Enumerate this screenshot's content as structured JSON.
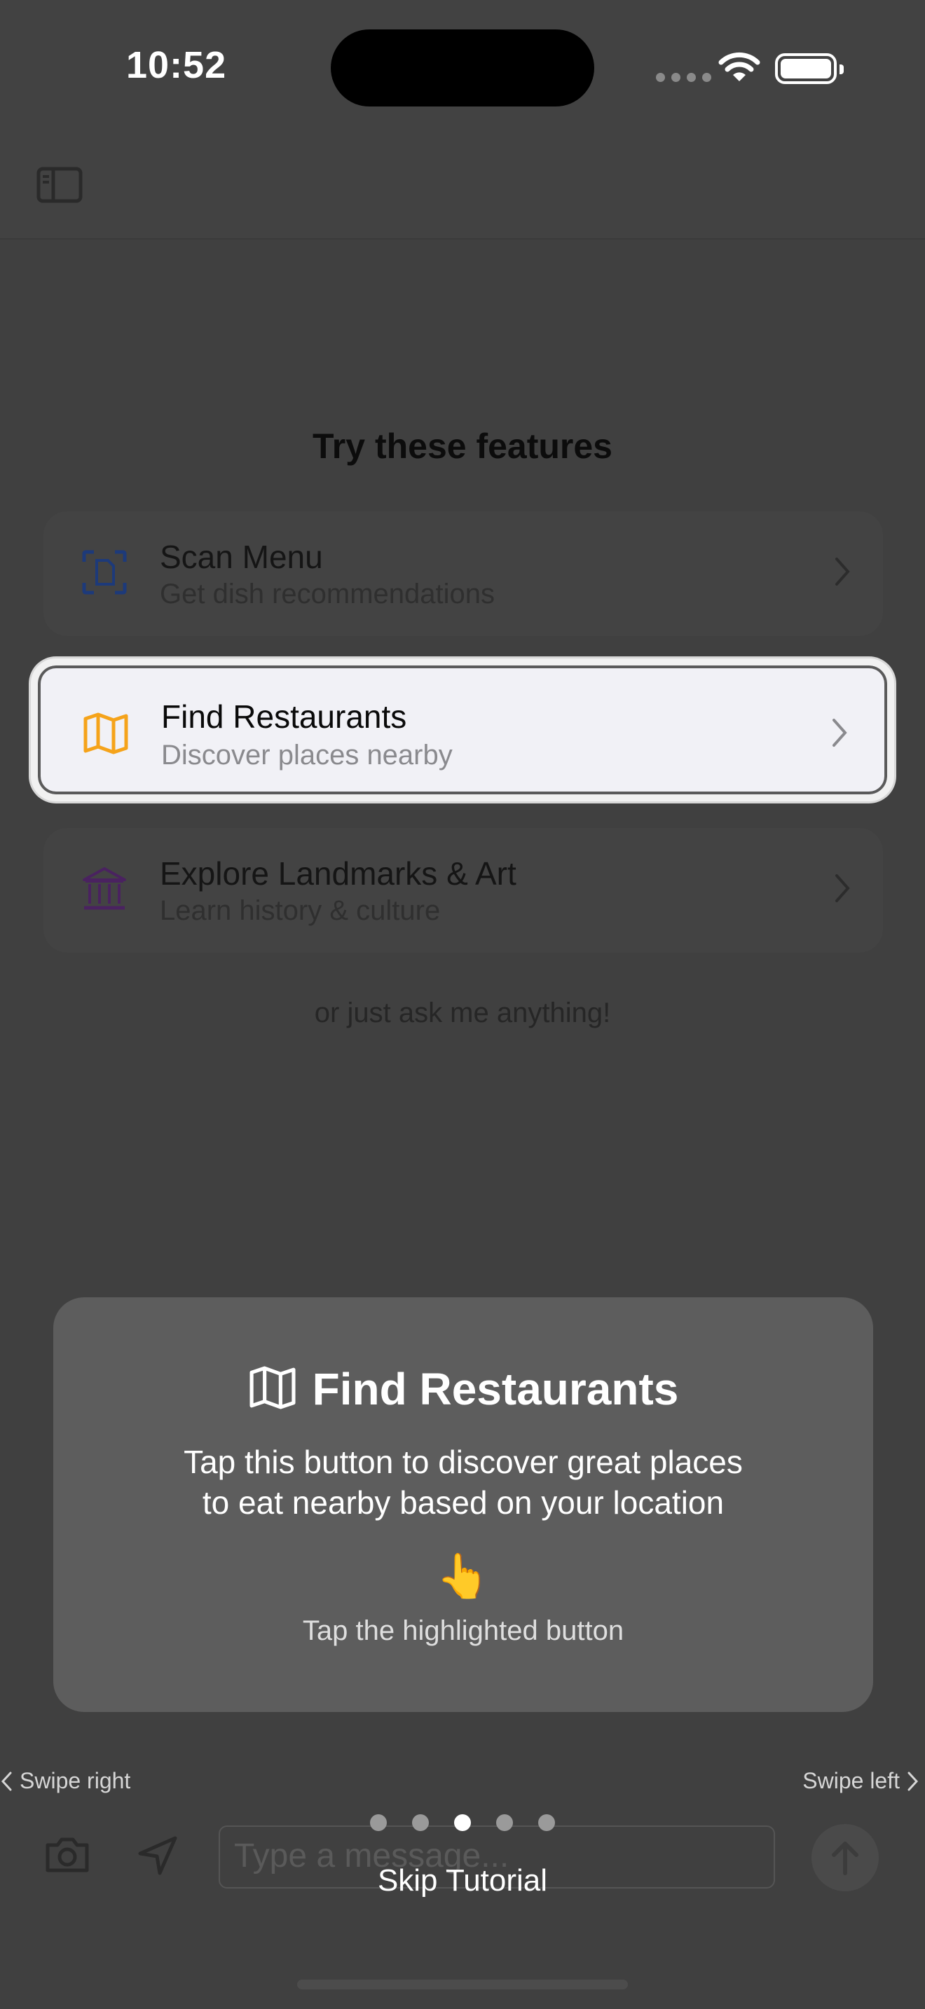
{
  "status_bar": {
    "time": "10:52"
  },
  "main": {
    "section_title": "Try these features",
    "cards": [
      {
        "title": "Scan Menu",
        "subtitle": "Get dish recommendations",
        "icon": "scan-document-icon",
        "color": "#1d3a7a"
      },
      {
        "title": "Find Restaurants",
        "subtitle": "Discover places nearby",
        "icon": "map-icon",
        "color": "#f5a31a"
      },
      {
        "title": "Explore Landmarks & Art",
        "subtitle": "Learn history & culture",
        "icon": "museum-icon",
        "color": "#4a2260"
      }
    ],
    "ask_text": "or just ask me anything!"
  },
  "composer": {
    "placeholder": "Type a message..."
  },
  "tutorial": {
    "title": "Find Restaurants",
    "body_line1": "Tap this button to discover great places",
    "body_line2": "to eat nearby based on your location",
    "hand": "👆",
    "hint": "Tap the highlighted button",
    "swipe_right": "Swipe right",
    "swipe_left": "Swipe left",
    "page_total": 5,
    "page_current": 3,
    "skip": "Skip Tutorial"
  }
}
